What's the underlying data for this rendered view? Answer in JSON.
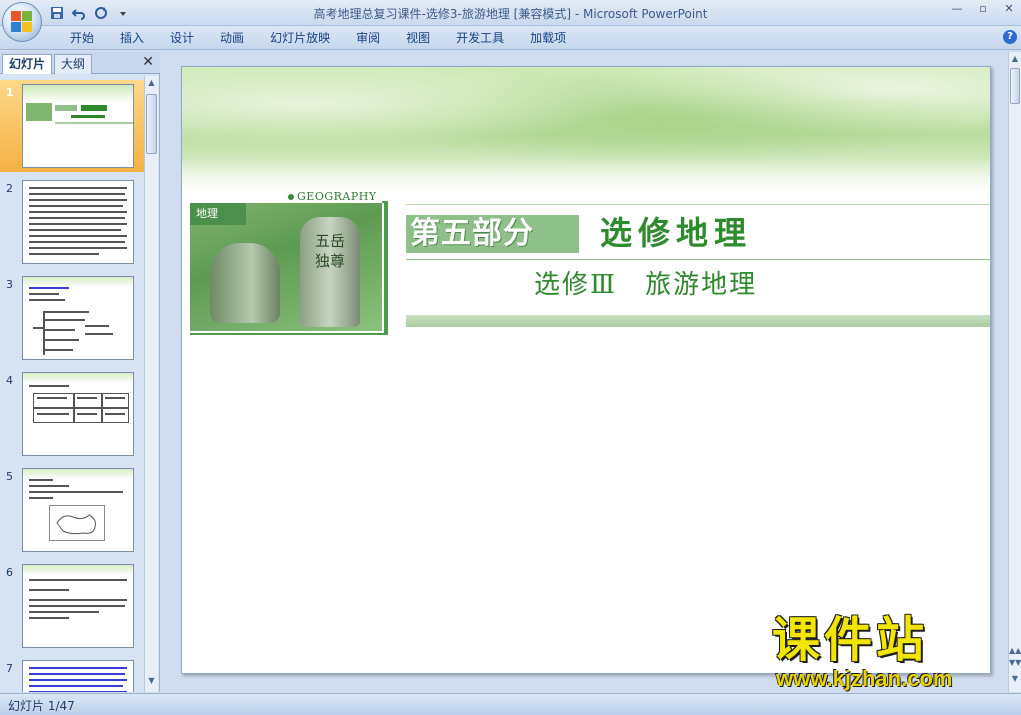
{
  "window": {
    "title": "高考地理总复习课件-选修3-旅游地理 [兼容模式] - Microsoft PowerPoint",
    "controls": [
      "—",
      "▫",
      "✕"
    ]
  },
  "quick_access": [
    "save-icon",
    "undo-icon",
    "redo-icon",
    "customize-icon"
  ],
  "ribbon": {
    "tabs": [
      "开始",
      "插入",
      "设计",
      "动画",
      "幻灯片放映",
      "审阅",
      "视图",
      "开发工具",
      "加载项"
    ],
    "help": "?"
  },
  "left_pane": {
    "tabs": [
      "幻灯片",
      "大纲"
    ],
    "close": "✕",
    "slides": [
      {
        "num": "1",
        "selected": true
      },
      {
        "num": "2"
      },
      {
        "num": "3"
      },
      {
        "num": "4"
      },
      {
        "num": "5"
      },
      {
        "num": "6"
      },
      {
        "num": "7"
      }
    ],
    "thumb3_title": "考点一 旅游资源的综合评价"
  },
  "slide": {
    "geography_label": "GEOGRAPHY",
    "photo_label": "地理",
    "photo_chars": "五岳独尊",
    "title_main": "第五部分",
    "title_sub": "选修地理",
    "subtitle": "选修Ⅲ　旅游地理"
  },
  "watermark": {
    "title": "课件站",
    "url": "www.kjzhan.com"
  },
  "status": {
    "slide_counter": "幻灯片 1/47"
  },
  "colors": {
    "accent_green": "#2d8a2d",
    "selection_orange": "#f5b143",
    "ribbon_text": "#15428b"
  }
}
